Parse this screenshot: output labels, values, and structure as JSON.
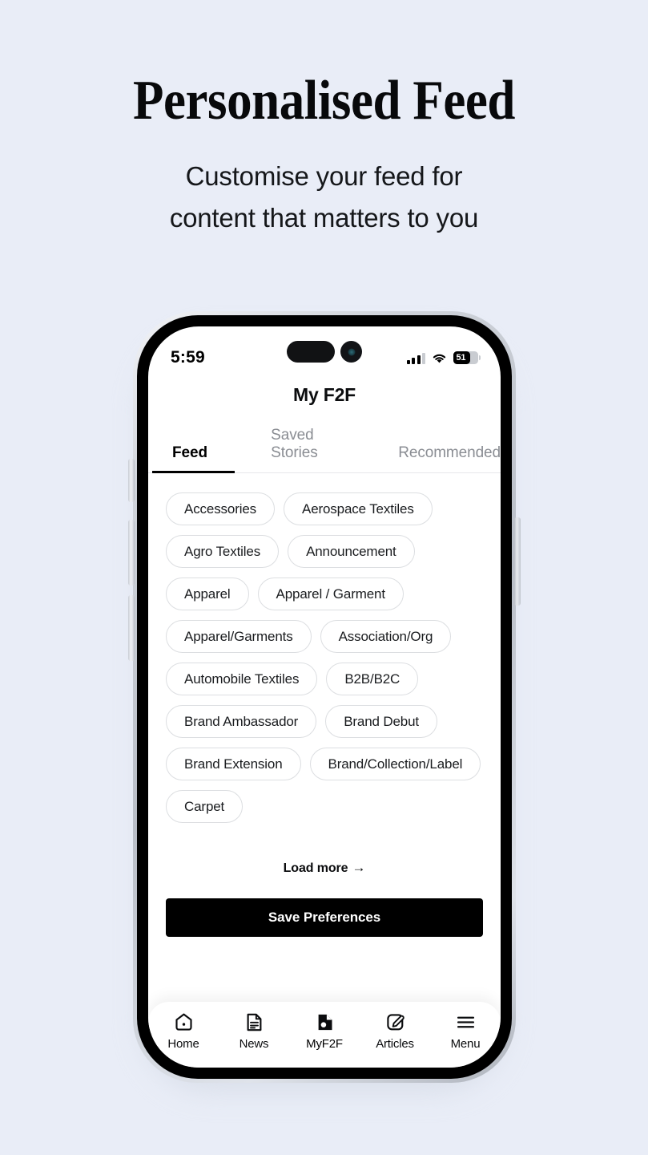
{
  "hero": {
    "title": "Personalised Feed",
    "subtitle_line1": "Customise your feed for",
    "subtitle_line2": "content that matters to you"
  },
  "colors": {
    "page_background": "#e9edf7",
    "accent": "#000000",
    "chip_border": "#dcdee1",
    "muted_text": "#8a8d93"
  },
  "phone": {
    "status_bar": {
      "time": "5:59",
      "battery_level": "51",
      "signal_icon": "cellular-bars-icon",
      "wifi_icon": "wifi-icon",
      "battery_icon": "battery-icon"
    },
    "app": {
      "title": "My F2F",
      "tabs": [
        {
          "label": "Feed",
          "active": true
        },
        {
          "label": "Saved Stories",
          "active": false
        },
        {
          "label": "Recommended",
          "active": false
        }
      ],
      "chips": [
        "Accessories",
        "Aerospace Textiles",
        "Agro Textiles",
        "Announcement",
        "Apparel",
        "Apparel / Garment",
        "Apparel/Garments",
        "Association/Org",
        "Automobile Textiles",
        "B2B/B2C",
        "Brand Ambassador",
        "Brand Debut",
        "Brand Extension",
        "Brand/Collection/Label",
        "Carpet"
      ],
      "load_more": {
        "label": "Load more",
        "arrow": "→"
      },
      "save_button": "Save Preferences",
      "bottom_nav": [
        {
          "label": "Home",
          "icon": "home-icon",
          "active": false
        },
        {
          "label": "News",
          "icon": "news-icon",
          "active": false
        },
        {
          "label": "MyF2F",
          "icon": "myf2f-icon",
          "active": true
        },
        {
          "label": "Articles",
          "icon": "articles-icon",
          "active": false
        },
        {
          "label": "Menu",
          "icon": "menu-icon",
          "active": false
        }
      ]
    },
    "hardware": {
      "silent_switch": "silent-switch",
      "volume_up": "volume-up-button",
      "volume_down": "volume-down-button",
      "power": "power-button"
    }
  }
}
